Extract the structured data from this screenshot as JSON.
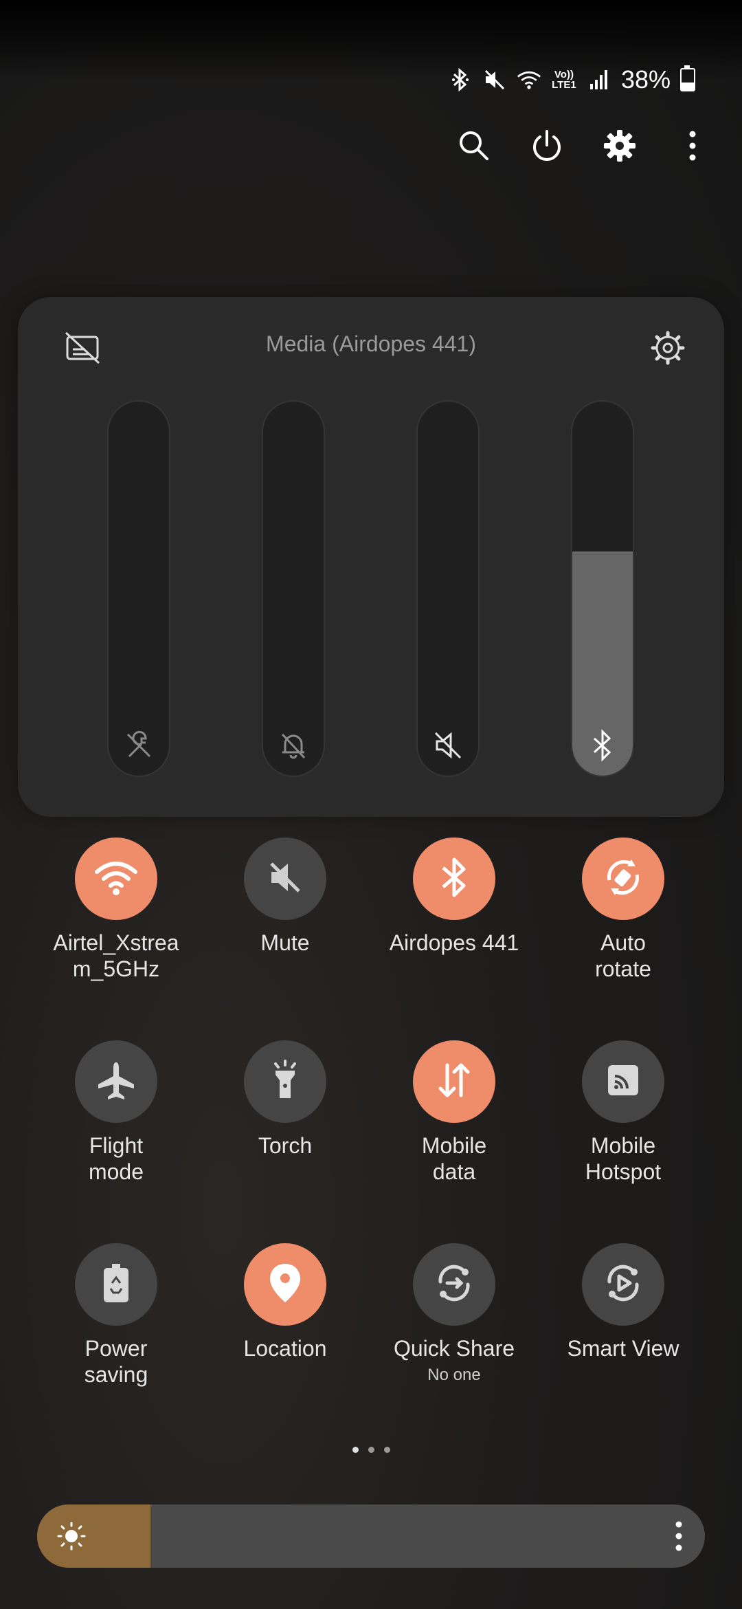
{
  "status_bar": {
    "battery_percent": "38%",
    "battery_level": 0.38,
    "volte_label": "Vo))\nLTE1",
    "icons": [
      "bluetooth-icon",
      "mute-icon",
      "wifi-icon",
      "volte-icon",
      "signal-icon",
      "battery-icon"
    ]
  },
  "header_actions": [
    {
      "name": "search",
      "icon": "search-icon"
    },
    {
      "name": "power",
      "icon": "power-icon"
    },
    {
      "name": "settings",
      "icon": "gear-icon"
    },
    {
      "name": "more",
      "icon": "more-vertical-icon"
    }
  ],
  "volume_panel": {
    "title": "Media (Airdopes 441)",
    "sliders": [
      {
        "name": "system",
        "icon": "wrench-icon",
        "level": 0
      },
      {
        "name": "notification",
        "icon": "bell-off-icon",
        "level": 0
      },
      {
        "name": "ringtone",
        "icon": "speaker-muted-icon",
        "level": 0
      },
      {
        "name": "media",
        "icon": "bluetooth-icon",
        "level": 0.6
      }
    ]
  },
  "tiles": [
    {
      "label": "Airtel_Xstrea\nm_5GHz",
      "state": "on",
      "icon": "wifi-icon"
    },
    {
      "label": "Mute",
      "state": "off",
      "icon": "mute-icon"
    },
    {
      "label": "Airdopes 441",
      "state": "on",
      "icon": "bluetooth-icon"
    },
    {
      "label": "Auto\nrotate",
      "state": "on",
      "icon": "auto-rotate-icon"
    },
    {
      "label": "Flight\nmode",
      "state": "off",
      "icon": "airplane-icon"
    },
    {
      "label": "Torch",
      "state": "off",
      "icon": "torch-icon"
    },
    {
      "label": "Mobile\ndata",
      "state": "on",
      "icon": "mobile-data-icon"
    },
    {
      "label": "Mobile\nHotspot",
      "state": "off",
      "icon": "hotspot-icon"
    },
    {
      "label": "Power\nsaving",
      "state": "off",
      "icon": "power-saving-icon"
    },
    {
      "label": "Location",
      "state": "on",
      "icon": "location-icon"
    },
    {
      "label": "Quick Share",
      "sub": "No one",
      "state": "off",
      "icon": "quick-share-icon"
    },
    {
      "label": "Smart View",
      "state": "off",
      "icon": "smart-view-icon"
    }
  ],
  "page_indicator": {
    "pages": 3,
    "current": 1
  },
  "brightness": {
    "level": 0.17,
    "icon": "sun-icon",
    "menu_icon": "more-vertical-icon"
  },
  "colors": {
    "accent": "#ef8c6a",
    "tile_off": "#454545",
    "brightness_fill": "#8e6a3a"
  }
}
